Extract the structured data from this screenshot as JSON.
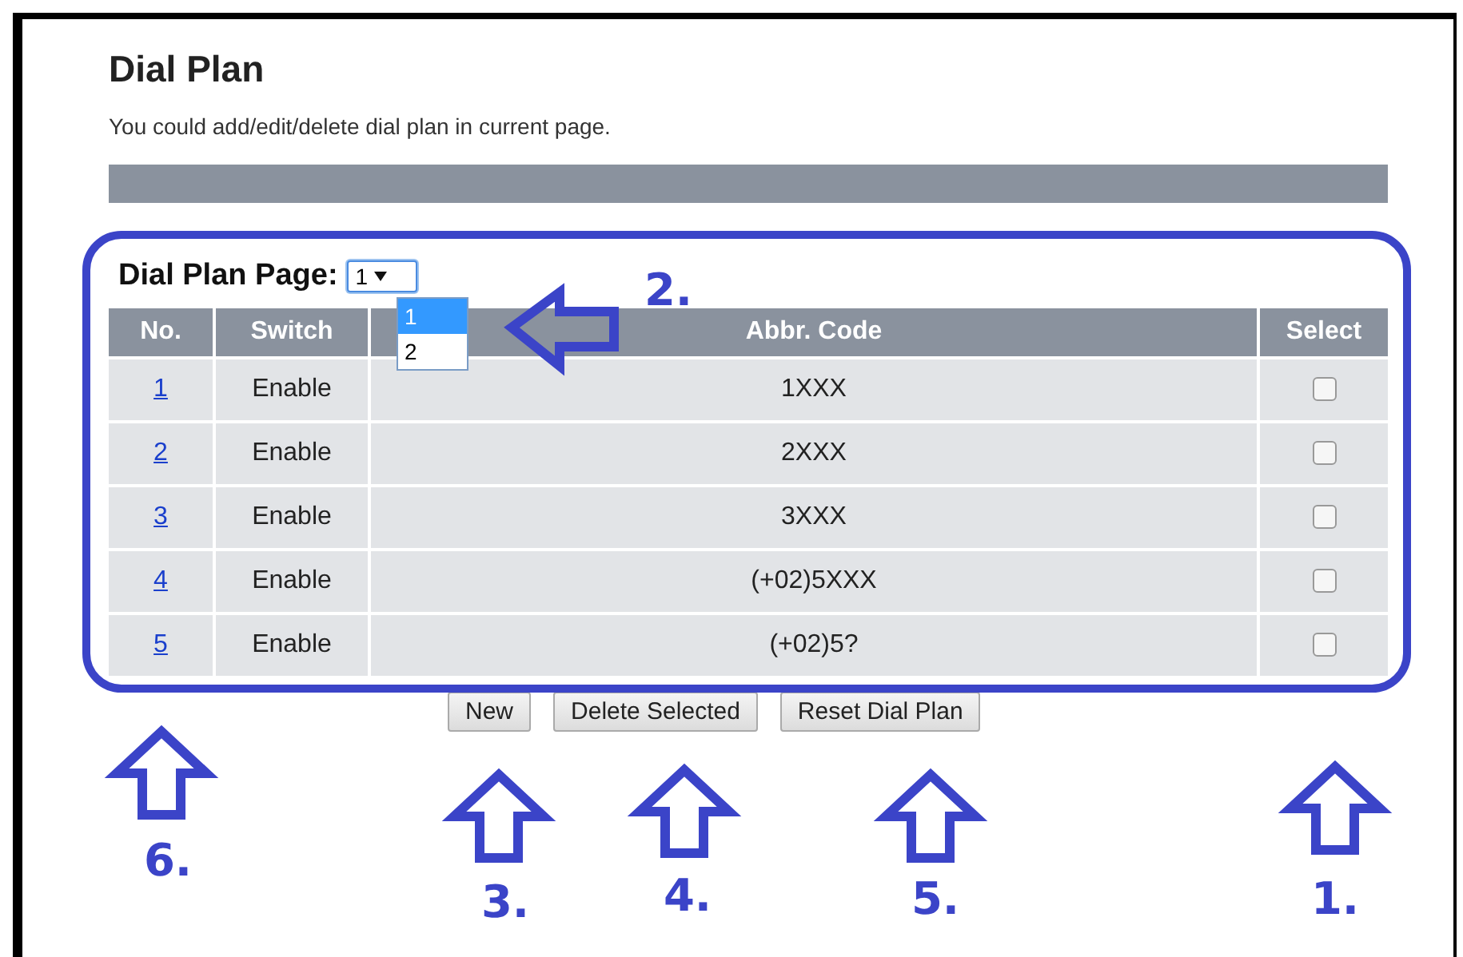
{
  "page": {
    "title": "Dial Plan",
    "description": "You could add/edit/delete dial plan in current page."
  },
  "page_selector": {
    "label": "Dial Plan Page:",
    "value": "1",
    "expanded": true,
    "options": [
      {
        "label": "1",
        "selected": true
      },
      {
        "label": "2",
        "selected": false
      }
    ]
  },
  "table": {
    "columns": [
      "No.",
      "Switch",
      "Abbr. Code",
      "Select"
    ],
    "rows": [
      {
        "no": "1",
        "switch": "Enable",
        "abbr_code": "1XXX",
        "checked": false
      },
      {
        "no": "2",
        "switch": "Enable",
        "abbr_code": "2XXX",
        "checked": false
      },
      {
        "no": "3",
        "switch": "Enable",
        "abbr_code": "3XXX",
        "checked": false
      },
      {
        "no": "4",
        "switch": "Enable",
        "abbr_code": "(+02)5XXX",
        "checked": false
      },
      {
        "no": "5",
        "switch": "Enable",
        "abbr_code": "(+02)5?",
        "checked": false
      }
    ]
  },
  "buttons": [
    "New",
    "Delete Selected",
    "Reset Dial Plan"
  ],
  "annotations": [
    {
      "label": "1.",
      "kind": "up"
    },
    {
      "label": "2.",
      "kind": "left"
    },
    {
      "label": "3.",
      "kind": "up"
    },
    {
      "label": "4.",
      "kind": "up"
    },
    {
      "label": "5.",
      "kind": "up"
    },
    {
      "label": "6.",
      "kind": "up"
    }
  ]
}
